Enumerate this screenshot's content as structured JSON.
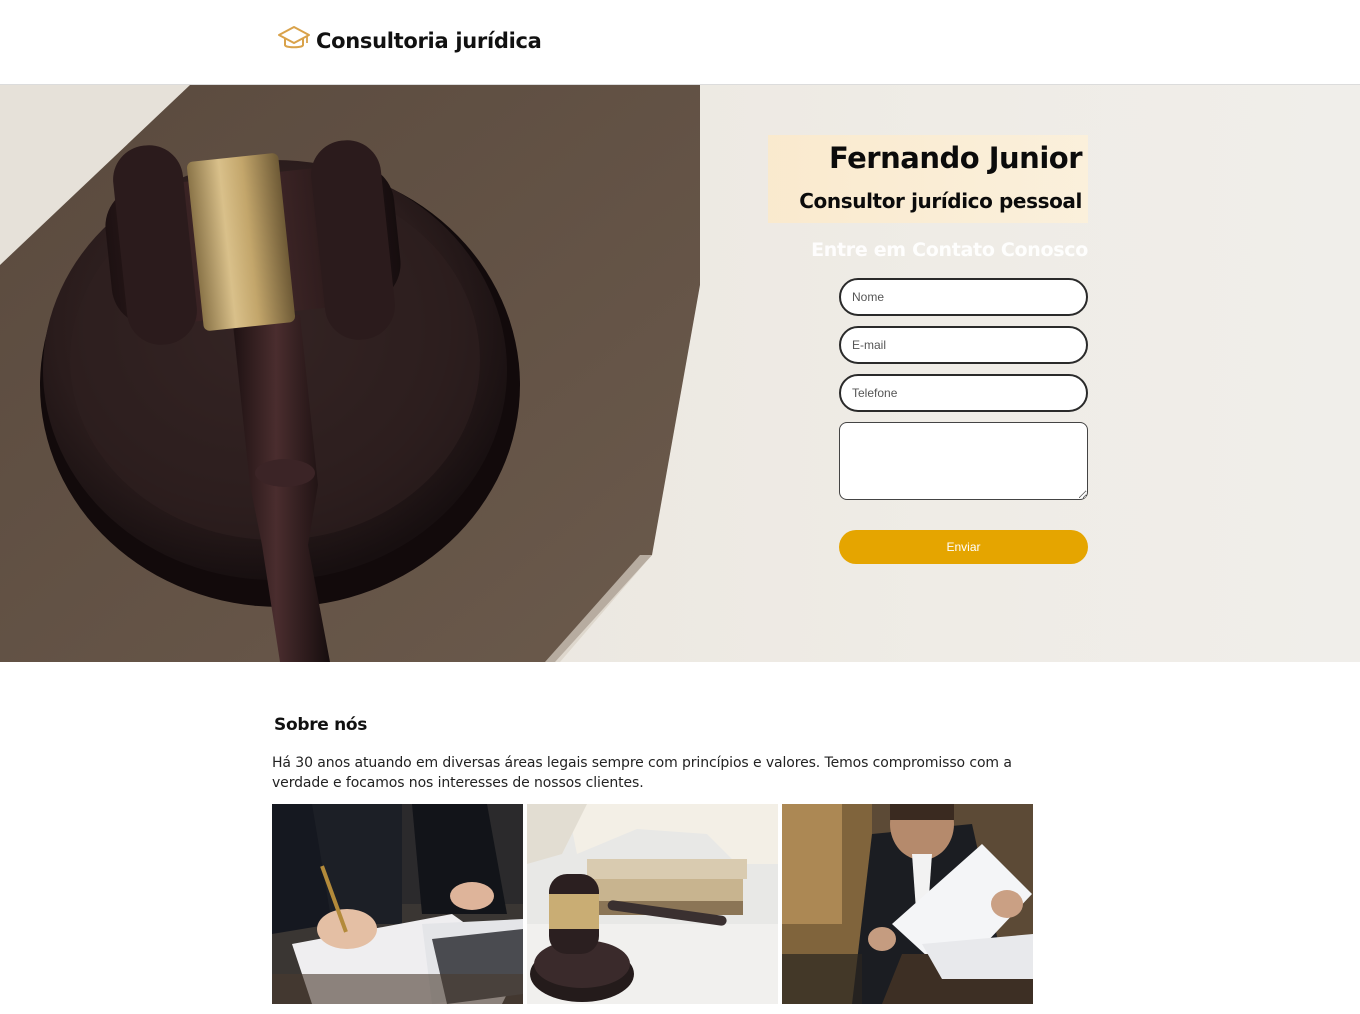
{
  "header": {
    "logo_icon": "graduation-cap-icon",
    "title": "Consultoria jurídica"
  },
  "hero": {
    "name": "Fernando Junior",
    "role": "Consultor jurídico pessoal",
    "contact_title": "Entre em Contato Conosco",
    "form": {
      "name_placeholder": "Nome",
      "email_placeholder": "E-mail",
      "phone_placeholder": "Telefone",
      "message_value": "",
      "submit_label": "Enviar"
    }
  },
  "about": {
    "title": "Sobre nós",
    "text": "Há 30 anos atuando em diversas áreas legais sempre com princípios e valores. Temos compromisso com a verdade e focamos nos interesses de nossos clientes."
  },
  "colors": {
    "accent": "#e5a500",
    "logo_icon": "#d9a24a"
  }
}
